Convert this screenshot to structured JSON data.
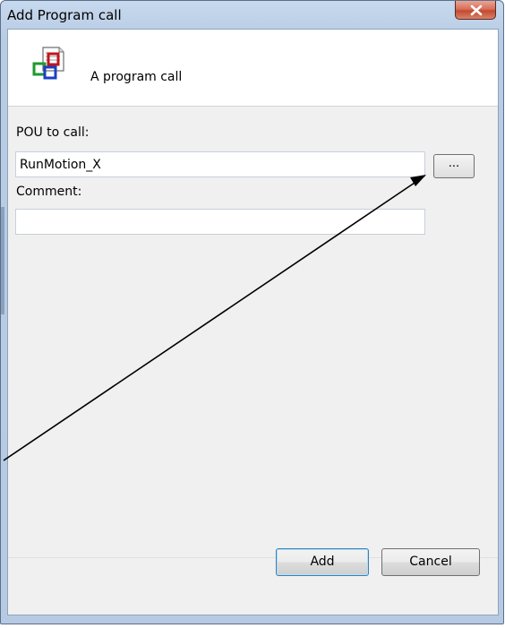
{
  "window": {
    "title": "Add Program call",
    "close_icon": "close-x-icon"
  },
  "header": {
    "icon": "program-call-icon",
    "text": "A program call"
  },
  "form": {
    "pou_label": "POU to call:",
    "pou_value": "RunMotion_X",
    "browse_label": "...",
    "comment_label": "Comment:",
    "comment_value": ""
  },
  "footer": {
    "add_label": "Add",
    "cancel_label": "Cancel"
  }
}
